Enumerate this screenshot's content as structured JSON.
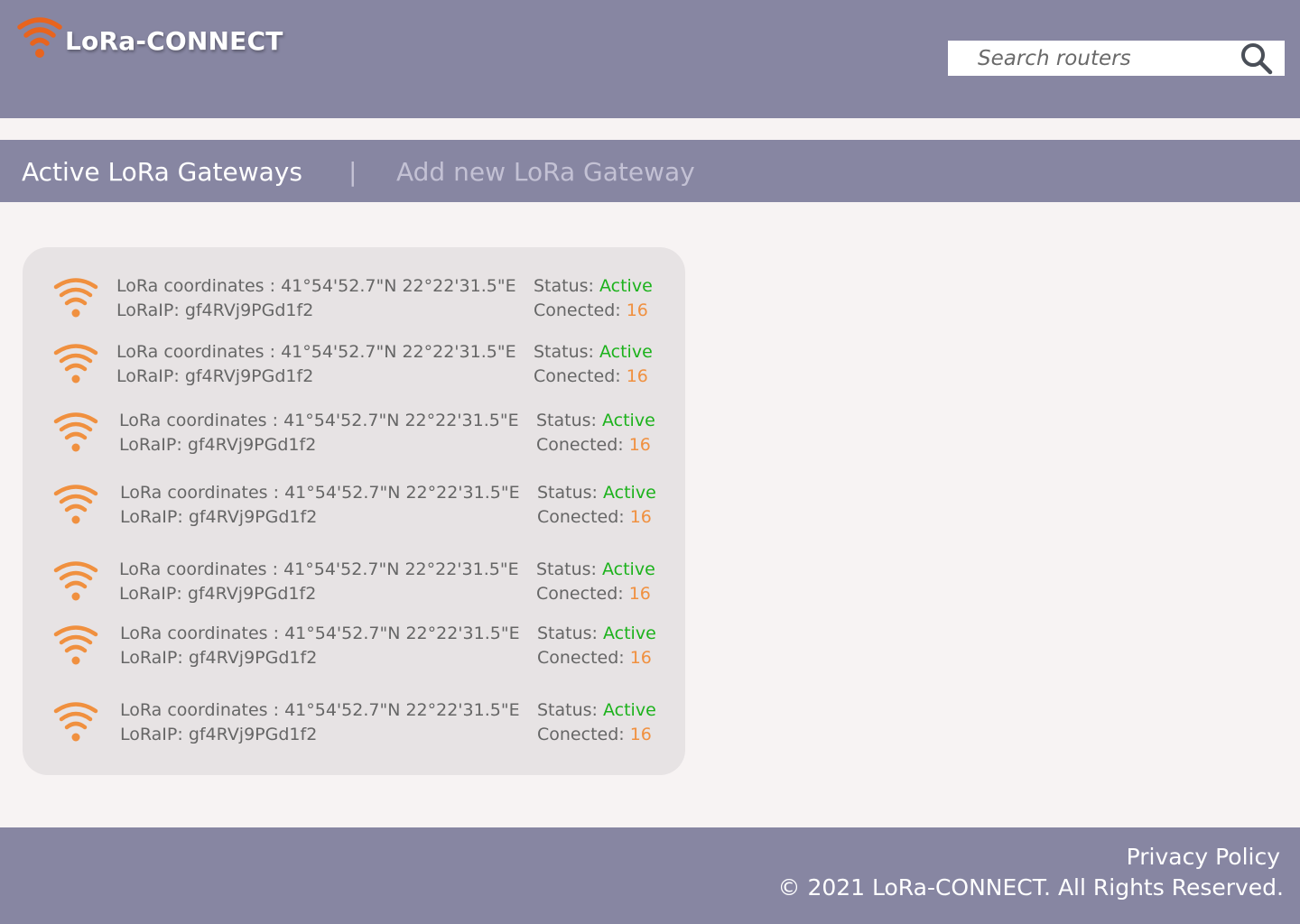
{
  "brand": {
    "name": "LoRa-CONNECT",
    "icon": "wifi-icon",
    "accent_color": "#e8641e"
  },
  "search": {
    "placeholder": "Search routers",
    "icon": "search-icon"
  },
  "tabs": {
    "active_label": "Active LoRa Gateways",
    "separator": "|",
    "add_label": "Add new LoRa Gateway"
  },
  "gateways": [
    {
      "coordinates_label": "LoRa coordinates :",
      "coordinates": "41°54'52.7\"N 22°22'31.5\"E",
      "ip_label": "LoRaIP:",
      "ip": "gf4RVj9PGd1f2",
      "status_label": "Status:",
      "status": "Active",
      "connected_label": "Conected:",
      "connected": "16"
    },
    {
      "coordinates_label": "LoRa coordinates :",
      "coordinates": "41°54'52.7\"N 22°22'31.5\"E",
      "ip_label": "LoRaIP:",
      "ip": "gf4RVj9PGd1f2",
      "status_label": "Status:",
      "status": "Active",
      "connected_label": "Conected:",
      "connected": "16"
    },
    {
      "coordinates_label": "LoRa coordinates :",
      "coordinates": "41°54'52.7\"N 22°22'31.5\"E",
      "ip_label": "LoRaIP:",
      "ip": "gf4RVj9PGd1f2",
      "status_label": "Status:",
      "status": "Active",
      "connected_label": "Conected:",
      "connected": "16"
    },
    {
      "coordinates_label": "LoRa coordinates :",
      "coordinates": "41°54'52.7\"N 22°22'31.5\"E",
      "ip_label": "LoRaIP:",
      "ip": "gf4RVj9PGd1f2",
      "status_label": "Status:",
      "status": "Active",
      "connected_label": "Conected:",
      "connected": "16"
    },
    {
      "coordinates_label": "LoRa coordinates :",
      "coordinates": "41°54'52.7\"N 22°22'31.5\"E",
      "ip_label": "LoRaIP:",
      "ip": "gf4RVj9PGd1f2",
      "status_label": "Status:",
      "status": "Active",
      "connected_label": "Conected:",
      "connected": "16"
    },
    {
      "coordinates_label": "LoRa coordinates :",
      "coordinates": "41°54'52.7\"N 22°22'31.5\"E",
      "ip_label": "LoRaIP:",
      "ip": "gf4RVj9PGd1f2",
      "status_label": "Status:",
      "status": "Active",
      "connected_label": "Conected:",
      "connected": "16"
    },
    {
      "coordinates_label": "LoRa coordinates :",
      "coordinates": "41°54'52.7\"N 22°22'31.5\"E",
      "ip_label": "LoRaIP:",
      "ip": "gf4RVj9PGd1f2",
      "status_label": "Status:",
      "status": "Active",
      "connected_label": "Conected:",
      "connected": "16"
    }
  ],
  "footer": {
    "privacy_label": "Privacy Policy",
    "copyright": "© 2021 LoRa-CONNECT. All Rights Reserved."
  },
  "colors": {
    "header_bg": "#8786a2",
    "page_bg": "#f7f3f3",
    "panel_bg": "#e7e3e4",
    "status_active": "#1cb21c",
    "count": "#f0903f",
    "gateway_icon": "#f0903f"
  }
}
